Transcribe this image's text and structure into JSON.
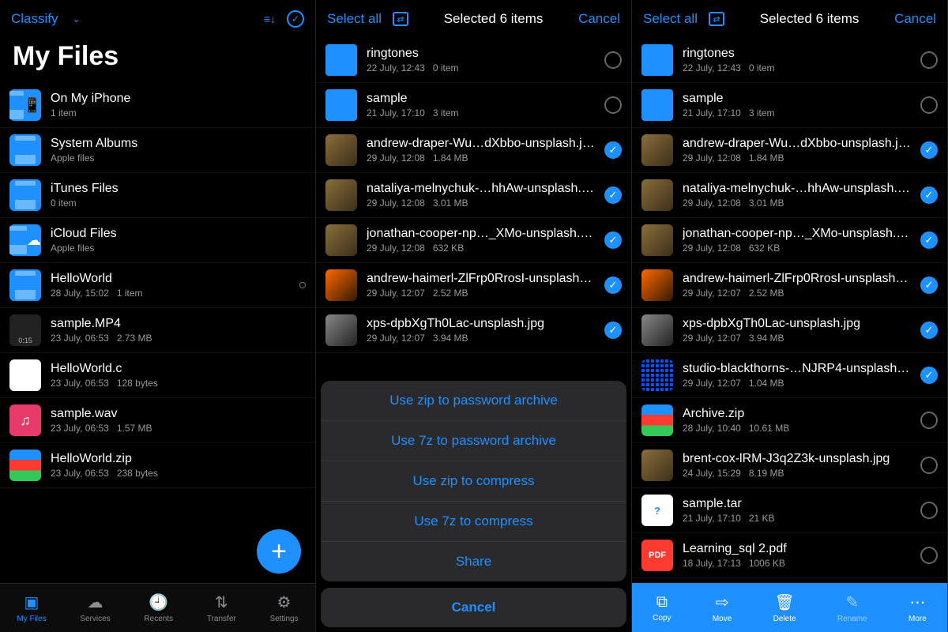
{
  "pane1": {
    "dropdown": "Classify",
    "title": "My Files",
    "items": [
      {
        "kind": "folder",
        "glyph": "📱",
        "name": "On My iPhone",
        "sub1": "1 item",
        "sub2": ""
      },
      {
        "kind": "folder",
        "glyph": "",
        "name": "System Albums",
        "sub1": "Apple files",
        "sub2": ""
      },
      {
        "kind": "folder",
        "glyph": "",
        "name": "iTunes Files",
        "sub1": "0 item",
        "sub2": ""
      },
      {
        "kind": "folder",
        "glyph": "☁",
        "name": "iCloud Files",
        "sub1": "Apple files",
        "sub2": ""
      },
      {
        "kind": "folder",
        "glyph": "",
        "name": "HelloWorld",
        "sub1": "28 July, 15:02",
        "sub2": "1 item",
        "dot": true
      },
      {
        "kind": "vid",
        "glyph": "0:15",
        "name": "sample.MP4",
        "sub1": "23 July, 06:53",
        "sub2": "2.73 MB"
      },
      {
        "kind": "doc",
        "glyph": "</>",
        "name": "HelloWorld.c",
        "sub1": "23 July, 06:53",
        "sub2": "128 bytes"
      },
      {
        "kind": "wav",
        "glyph": "♫",
        "name": "sample.wav",
        "sub1": "23 July, 06:53",
        "sub2": "1.57 MB"
      },
      {
        "kind": "zip",
        "glyph": "",
        "name": "HelloWorld.zip",
        "sub1": "23 July, 06:53",
        "sub2": "238 bytes"
      }
    ],
    "tabs": [
      {
        "label": "My Files",
        "glyph": "▣",
        "active": true
      },
      {
        "label": "Services",
        "glyph": "☁"
      },
      {
        "label": "Recents",
        "glyph": "🕘"
      },
      {
        "label": "Transfer",
        "glyph": "⇅"
      },
      {
        "label": "Settings",
        "glyph": "⚙"
      }
    ]
  },
  "pane2": {
    "selectAll": "Select all",
    "title": "Selected 6 items",
    "cancel": "Cancel",
    "items": [
      {
        "kind": "folder2",
        "name": "ringtones",
        "sub1": "22 July, 12:43",
        "sub2": "0 item",
        "sel": false
      },
      {
        "kind": "folder2",
        "name": "sample",
        "sub1": "21 July, 17:10",
        "sub2": "3 item",
        "sel": false
      },
      {
        "kind": "pic",
        "name": "andrew-draper-Wu…dXbbo-unsplash.jpg",
        "sub1": "29 July, 12:08",
        "sub2": "1.84 MB",
        "sel": true
      },
      {
        "kind": "pic",
        "name": "nataliya-melnychuk-…hhAw-unsplash.jpg",
        "sub1": "29 July, 12:08",
        "sub2": "3.01 MB",
        "sel": true
      },
      {
        "kind": "pic",
        "name": "jonathan-cooper-np…_XMo-unsplash.jpg",
        "sub1": "29 July, 12:08",
        "sub2": "632 KB",
        "sel": true
      },
      {
        "kind": "pic o",
        "name": "andrew-haimerl-ZlFrp0RrosI-unsplash.jpg",
        "sub1": "29 July, 12:07",
        "sub2": "2.52 MB",
        "sel": true
      },
      {
        "kind": "pic g",
        "name": "xps-dpbXgTh0Lac-unsplash.jpg",
        "sub1": "29 July, 12:07",
        "sub2": "3.94 MB",
        "sel": true
      }
    ],
    "sheet": [
      "Use zip to password archive",
      "Use 7z to password archive",
      "Use zip to compress",
      "Use 7z to compress",
      "Share"
    ],
    "sheetCancel": "Cancel",
    "hiddenRow": {
      "sub1": "18 July, 17:13",
      "sub2": "1006 KB"
    }
  },
  "pane3": {
    "selectAll": "Select all",
    "title": "Selected 6 items",
    "cancel": "Cancel",
    "items": [
      {
        "kind": "folder2",
        "name": "ringtones",
        "sub1": "22 July, 12:43",
        "sub2": "0 item",
        "sel": false
      },
      {
        "kind": "folder2",
        "name": "sample",
        "sub1": "21 July, 17:10",
        "sub2": "3 item",
        "sel": false
      },
      {
        "kind": "pic",
        "name": "andrew-draper-Wu…dXbbo-unsplash.jpg",
        "sub1": "29 July, 12:08",
        "sub2": "1.84 MB",
        "sel": true
      },
      {
        "kind": "pic",
        "name": "nataliya-melnychuk-…hhAw-unsplash.jpg",
        "sub1": "29 July, 12:08",
        "sub2": "3.01 MB",
        "sel": true
      },
      {
        "kind": "pic",
        "name": "jonathan-cooper-np…_XMo-unsplash.jpg",
        "sub1": "29 July, 12:08",
        "sub2": "632 KB",
        "sel": true
      },
      {
        "kind": "pic o",
        "name": "andrew-haimerl-ZlFrp0RrosI-unsplash.jpg",
        "sub1": "29 July, 12:07",
        "sub2": "2.52 MB",
        "sel": true
      },
      {
        "kind": "pic g",
        "name": "xps-dpbXgTh0Lac-unsplash.jpg",
        "sub1": "29 July, 12:07",
        "sub2": "3.94 MB",
        "sel": true
      },
      {
        "kind": "grid9",
        "name": "studio-blackthorns-…NJRP4-unsplash.jpg",
        "sub1": "29 July, 12:07",
        "sub2": "1.04 MB",
        "sel": true
      },
      {
        "kind": "zip",
        "name": "Archive.zip",
        "sub1": "28 July, 10:40",
        "sub2": "10.61 MB",
        "sel": false
      },
      {
        "kind": "pic",
        "name": "brent-cox-lRM-J3q2Z3k-unsplash.jpg",
        "sub1": "24 July, 15:29",
        "sub2": "8.19 MB",
        "sel": false
      },
      {
        "kind": "doc",
        "glyph": "?",
        "name": "sample.tar",
        "sub1": "21 July, 17:10",
        "sub2": "21 KB",
        "sel": false
      },
      {
        "kind": "pdf",
        "glyph": "PDF",
        "name": "Learning_sql 2.pdf",
        "sub1": "18 July, 17:13",
        "sub2": "1006 KB",
        "sel": false
      }
    ],
    "tools": [
      {
        "label": "Copy",
        "glyph": "⧉"
      },
      {
        "label": "Move",
        "glyph": "⇨"
      },
      {
        "label": "Delete",
        "glyph": "🗑"
      },
      {
        "label": "Rename",
        "glyph": "✎",
        "dim": true
      },
      {
        "label": "More",
        "glyph": "⋯"
      }
    ]
  }
}
